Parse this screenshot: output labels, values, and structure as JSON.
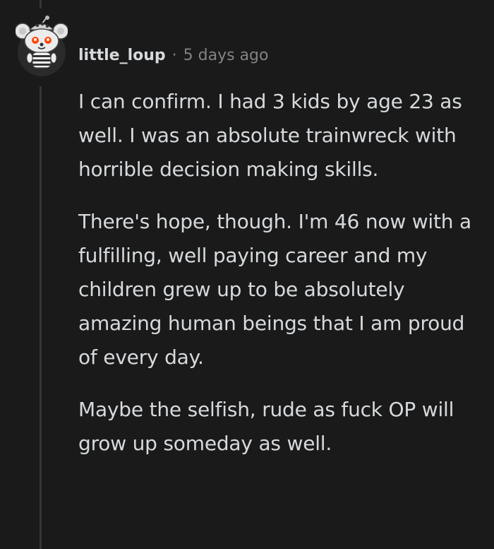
{
  "comment": {
    "author": "little_loup",
    "separator": "·",
    "timestamp": "5 days ago",
    "paragraphs": [
      "I can confirm. I had 3 kids by age 23 as well. I was an absolute trainwreck with horrible decision making skills.",
      "There's hope, though. I'm 46 now with a fulfilling, well paying career and my children grew up to be absolutely amazing human beings that I am proud of every day.",
      "Maybe the selfish, rude as fuck OP will grow up someday as well."
    ]
  },
  "avatar": {
    "icon": "snoo-avatar-icon"
  },
  "colors": {
    "background": "#1a1a1b",
    "text": "#d7dadc",
    "meta": "#818384",
    "thread_line": "#343536",
    "avatar_bg": "#dadada",
    "avatar_eye": "#ff4500"
  }
}
